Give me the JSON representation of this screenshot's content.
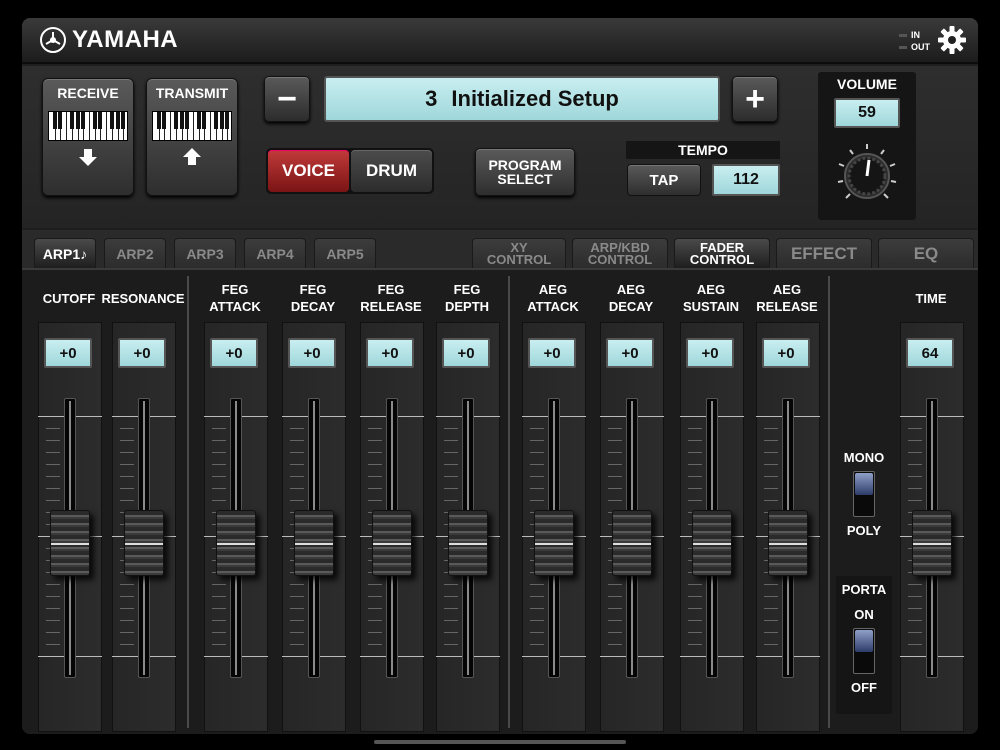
{
  "brand": {
    "name": "YAMAHA"
  },
  "io": {
    "in_label": "IN",
    "out_label": "OUT"
  },
  "header": {
    "receive_label": "RECEIVE",
    "transmit_label": "TRANSMIT",
    "minus_label": "−",
    "plus_label": "+",
    "program_number": "3",
    "program_name": "Initialized Setup",
    "voice_label": "VOICE",
    "drum_label": "DRUM",
    "voice_drum_selected": "VOICE",
    "program_select_line1": "PROGRAM",
    "program_select_line2": "SELECT",
    "tempo_label": "TEMPO",
    "tap_label": "TAP",
    "tempo_value": "112",
    "volume_label": "VOLUME",
    "volume_value": "59"
  },
  "tabs": {
    "arp": [
      "ARP1♪",
      "ARP2",
      "ARP3",
      "ARP4",
      "ARP5"
    ],
    "arp_active": "ARP1♪",
    "xy": [
      "XY",
      "CONTROL"
    ],
    "arpkbd": [
      "ARP/KBD",
      "CONTROL"
    ],
    "fader": [
      "FADER",
      "CONTROL"
    ],
    "effect": "EFFECT",
    "eq": "EQ",
    "active": "FADER CONTROL"
  },
  "faders": [
    {
      "line1": "CUTOFF",
      "line2": "",
      "value": "+0",
      "level": 0.5
    },
    {
      "line1": "RESONANCE",
      "line2": "",
      "value": "+0",
      "level": 0.5
    },
    {
      "line1": "FEG",
      "line2": "ATTACK",
      "value": "+0",
      "level": 0.5
    },
    {
      "line1": "FEG",
      "line2": "DECAY",
      "value": "+0",
      "level": 0.5
    },
    {
      "line1": "FEG",
      "line2": "RELEASE",
      "value": "+0",
      "level": 0.5
    },
    {
      "line1": "FEG",
      "line2": "DEPTH",
      "value": "+0",
      "level": 0.5
    },
    {
      "line1": "AEG",
      "line2": "ATTACK",
      "value": "+0",
      "level": 0.5
    },
    {
      "line1": "AEG",
      "line2": "DECAY",
      "value": "+0",
      "level": 0.5
    },
    {
      "line1": "AEG",
      "line2": "SUSTAIN",
      "value": "+0",
      "level": 0.5
    },
    {
      "line1": "AEG",
      "line2": "RELEASE",
      "value": "+0",
      "level": 0.5
    },
    {
      "line1": "TIME",
      "line2": "",
      "value": "64",
      "level": 0.5
    }
  ],
  "mono_poly": {
    "mono_label": "MONO",
    "poly_label": "POLY",
    "state": "POLY"
  },
  "porta": {
    "title": "PORTA",
    "on_label": "ON",
    "off_label": "OFF",
    "state": "OFF"
  },
  "colors": {
    "accent_red": "#b02828",
    "lcd": "#b4e4e8",
    "panel": "#1e1e1e"
  }
}
